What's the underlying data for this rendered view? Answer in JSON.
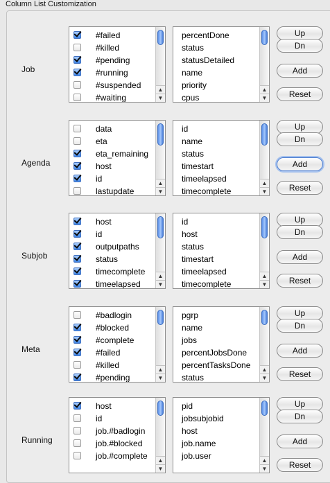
{
  "group_title": "Column List Customization",
  "buttons": {
    "up": "Up",
    "down": "Dn",
    "add": "Add",
    "reset": "Reset"
  },
  "focused_add_section": "Agenda",
  "sections": [
    {
      "label": "Job",
      "available": [
        {
          "text": "#failed",
          "checked": true
        },
        {
          "text": "#killed",
          "checked": false
        },
        {
          "text": "#pending",
          "checked": true
        },
        {
          "text": "#running",
          "checked": true
        },
        {
          "text": "#suspended",
          "checked": false
        },
        {
          "text": "#waiting",
          "checked": false
        }
      ],
      "selected": [
        "percentDone",
        "status",
        "statusDetailed",
        "name",
        "priority",
        "cpus"
      ]
    },
    {
      "label": "Agenda",
      "available": [
        {
          "text": "data",
          "checked": false
        },
        {
          "text": "eta",
          "checked": false
        },
        {
          "text": "eta_remaining",
          "checked": true
        },
        {
          "text": "host",
          "checked": true
        },
        {
          "text": "id",
          "checked": true
        },
        {
          "text": "lastupdate",
          "checked": false
        }
      ],
      "selected": [
        "id",
        "name",
        "status",
        "timestart",
        "timeelapsed",
        "timecomplete"
      ]
    },
    {
      "label": "Subjob",
      "available": [
        {
          "text": "host",
          "checked": true
        },
        {
          "text": "id",
          "checked": true
        },
        {
          "text": "outputpaths",
          "checked": true
        },
        {
          "text": "status",
          "checked": true
        },
        {
          "text": "timecomplete",
          "checked": true
        },
        {
          "text": "timeelapsed",
          "checked": true
        }
      ],
      "selected": [
        "id",
        "host",
        "status",
        "timestart",
        "timeelapsed",
        "timecomplete"
      ]
    },
    {
      "label": "Meta",
      "available": [
        {
          "text": "#badlogin",
          "checked": false
        },
        {
          "text": "#blocked",
          "checked": true
        },
        {
          "text": "#complete",
          "checked": true
        },
        {
          "text": "#failed",
          "checked": true
        },
        {
          "text": "#killed",
          "checked": false
        },
        {
          "text": "#pending",
          "checked": true
        }
      ],
      "selected": [
        "pgrp",
        "name",
        "jobs",
        "percentJobsDone",
        "percentTasksDone",
        "status"
      ]
    },
    {
      "label": "Running",
      "available": [
        {
          "text": "host",
          "checked": true
        },
        {
          "text": "id",
          "checked": false
        },
        {
          "text": "job.#badlogin",
          "checked": false
        },
        {
          "text": "job.#blocked",
          "checked": false
        },
        {
          "text": "job.#complete",
          "checked": false
        }
      ],
      "selected": [
        "pid",
        "jobsubjobid",
        "host",
        "job.name",
        "job.user"
      ]
    }
  ]
}
